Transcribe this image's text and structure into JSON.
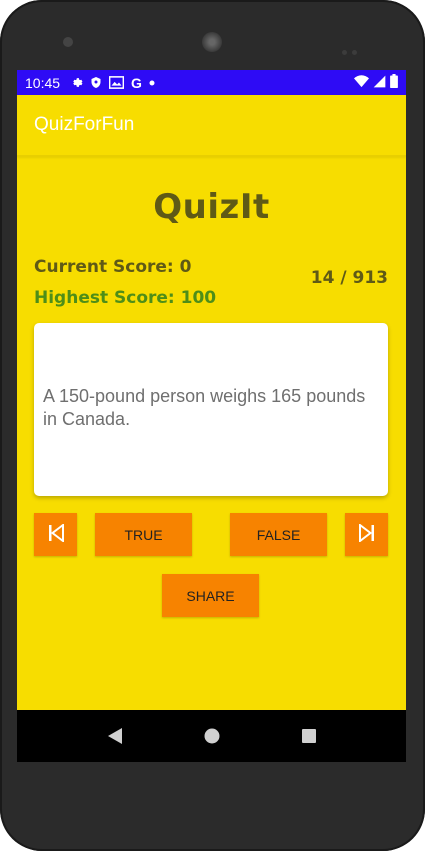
{
  "status": {
    "time": "10:45",
    "icons": [
      "gear-icon",
      "shield-icon",
      "mail-icon",
      "google-icon",
      "dot-icon"
    ],
    "right_icons": [
      "wifi-icon",
      "signal-icon",
      "battery-icon"
    ],
    "bar_color": "#2e0bf5"
  },
  "appbar": {
    "title": "QuizForFun"
  },
  "quiz": {
    "title": "QuizIt",
    "current_score": "Current Score: 0",
    "highest_score": "Highest Score: 100",
    "progress": "14 / 913",
    "question": "A 150-pound person weighs 165 pounds in Canada."
  },
  "buttons": {
    "true_label": "TRUE",
    "false_label": "FALSE",
    "share_label": "SHARE"
  },
  "colors": {
    "background": "#f7dd00",
    "button": "#f78300",
    "title_text": "#5f5a16",
    "highscore_text": "#4e8e18"
  }
}
